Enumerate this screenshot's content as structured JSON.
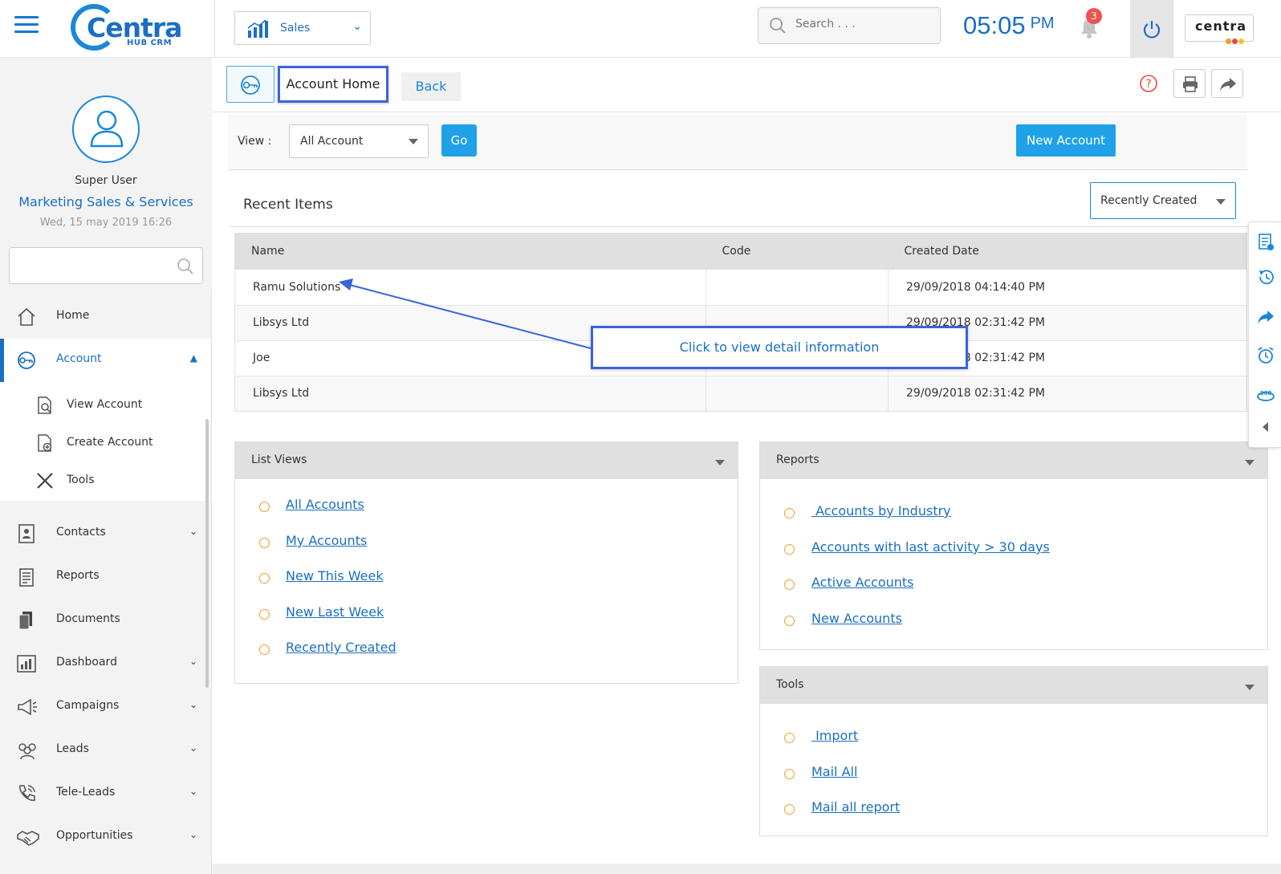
{
  "header": {
    "logo_text": "Centra",
    "logo_sub": "HUB CRM",
    "module": "Sales",
    "search_placeholder": "Search . . .",
    "time": "05:05",
    "ampm": "PM",
    "notif_count": "3",
    "brand_text": "centra",
    "accent_color": "#1a6fc4"
  },
  "profile": {
    "name": "Super User",
    "org": "Marketing Sales & Services",
    "datetime": "Wed, 15 may 2019 16:26"
  },
  "sidebar": {
    "items": [
      {
        "label": "Home"
      },
      {
        "label": "Account"
      },
      {
        "label": "Contacts"
      },
      {
        "label": "Reports"
      },
      {
        "label": "Documents"
      },
      {
        "label": "Dashboard"
      },
      {
        "label": "Campaigns"
      },
      {
        "label": "Leads"
      },
      {
        "label": "Tele-Leads"
      },
      {
        "label": "Opportunities"
      }
    ],
    "subitems": [
      {
        "label": "View Account"
      },
      {
        "label": "Create Account"
      },
      {
        "label": "Tools"
      }
    ]
  },
  "toolbar": {
    "title": "Account Home",
    "back_label": "Back"
  },
  "viewbar": {
    "view_label": "View :",
    "view_value": "All Account",
    "go_label": "Go",
    "new_account_label": "New Account"
  },
  "recent": {
    "title": "Recent Items",
    "sort_value": "Recently Created",
    "columns": [
      "Name",
      "Code",
      "Created Date"
    ],
    "rows": [
      {
        "name": "Ramu Solutions",
        "code": "",
        "date": "29/09/2018 04:14:40 PM"
      },
      {
        "name": "Libsys Ltd",
        "code": "",
        "date": "29/09/2018 02:31:42 PM"
      },
      {
        "name": "Joe",
        "code": "",
        "date": "29/09/2018 02:31:42 PM"
      },
      {
        "name": "Libsys Ltd",
        "code": "",
        "date": "29/09/2018 02:31:42 PM"
      }
    ]
  },
  "callout": {
    "text": "Click to view detail information"
  },
  "list_views": {
    "title": "List Views",
    "links": [
      "All Accounts",
      "My Accounts",
      "New This Week",
      "New Last Week",
      "Recently Created"
    ]
  },
  "reports": {
    "title": "Reports",
    "links": [
      " Accounts by Industry",
      "Accounts with last activity > 30 days",
      "Active Accounts",
      "New Accounts"
    ]
  },
  "tools": {
    "title": "Tools",
    "links": [
      " Import",
      "Mail All",
      "Mail all report"
    ]
  }
}
